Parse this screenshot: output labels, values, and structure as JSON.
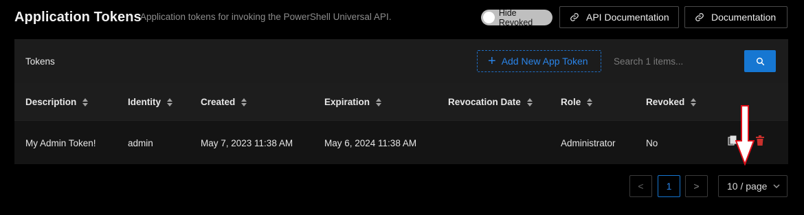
{
  "header": {
    "title": "Application Tokens",
    "subtitle": "Application tokens for invoking the PowerShell Universal API.",
    "toggle_label": "Hide Revoked",
    "api_docs_label": "API Documentation",
    "docs_label": "Documentation"
  },
  "card": {
    "title": "Tokens",
    "add_label": "Add New App Token",
    "search_placeholder": "Search 1 items..."
  },
  "table": {
    "columns": [
      "Description",
      "Identity",
      "Created",
      "Expiration",
      "Revocation Date",
      "Role",
      "Revoked"
    ],
    "rows": [
      {
        "description": "My Admin Token!",
        "identity": "admin",
        "created": "May 7, 2023 11:38 AM",
        "expiration": "May 6, 2024 11:38 AM",
        "revocation_date": "",
        "role": "Administrator",
        "revoked": "No"
      }
    ]
  },
  "pagination": {
    "prev": "<",
    "current_page": "1",
    "next": ">",
    "page_size": "10 / page"
  },
  "colors": {
    "accent": "#1677d2",
    "delete": "#c9302c",
    "annotation_arrow": "#e0101a"
  }
}
